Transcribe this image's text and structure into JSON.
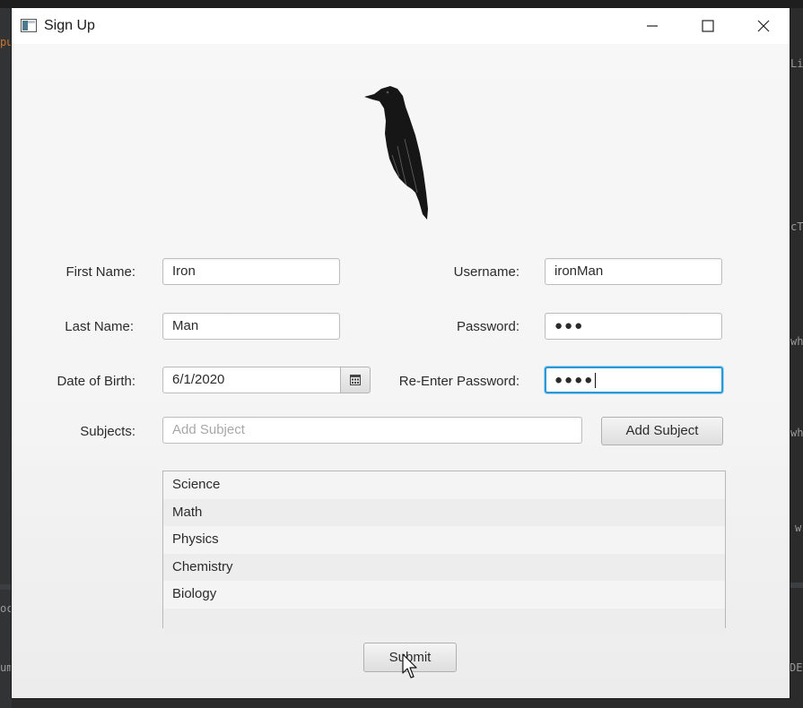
{
  "window": {
    "title": "Sign Up",
    "controls": [
      "minimize",
      "maximize",
      "close"
    ]
  },
  "form": {
    "first_name": {
      "label": "First Name:",
      "value": "Iron"
    },
    "last_name": {
      "label": "Last Name:",
      "value": "Man"
    },
    "date_of_birth": {
      "label": "Date of Birth:",
      "value": "6/1/2020"
    },
    "username": {
      "label": "Username:",
      "value": "ironMan"
    },
    "password": {
      "label": "Password:",
      "masked_value": "●●●"
    },
    "reenter_password": {
      "label": "Re-Enter Password:",
      "masked_value": "●●●●"
    },
    "subjects": {
      "label": "Subjects:",
      "placeholder": "Add Subject",
      "value": ""
    }
  },
  "buttons": {
    "add_subject": "Add Subject",
    "submit": "Submit"
  },
  "subject_list": [
    "Science",
    "Math",
    "Physics",
    "Chemistry",
    "Biology"
  ],
  "ide_background": {
    "fragments": [
      "pu",
      "Li",
      "cT",
      "wh",
      "wh",
      "w",
      "oc",
      "um",
      "DE"
    ]
  },
  "colors": {
    "focus_border": "#2a97d6",
    "window_bg": "#f5f5f5"
  },
  "icons": [
    "app-icon",
    "minimize-icon",
    "maximize-icon",
    "close-icon",
    "raven-logo",
    "calendar-icon",
    "mouse-cursor-icon"
  ]
}
